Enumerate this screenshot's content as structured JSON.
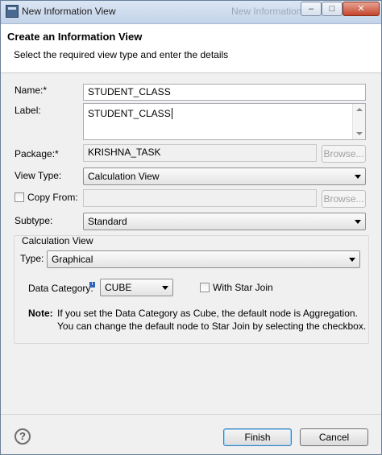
{
  "window": {
    "title": "New Information View",
    "ghost_title": "New Information View",
    "min_glyph": "–",
    "max_glyph": "□",
    "close_glyph": "✕"
  },
  "header": {
    "title": "Create an Information View",
    "subtitle": "Select the required view type and enter the details"
  },
  "form": {
    "name_label": "Name:*",
    "name_value": "STUDENT_CLASS",
    "label_label": "Label:",
    "label_value": "STUDENT_CLASS",
    "package_label": "Package:*",
    "package_value": "KRISHNA_TASK",
    "browse_label": "Browse...",
    "view_type_label": "View Type:",
    "view_type_value": "Calculation View",
    "copy_from_label": "Copy From:",
    "copy_from_value": "",
    "subtype_label": "Subtype:",
    "subtype_value": "Standard"
  },
  "calc_group": {
    "title": "Calculation View",
    "type_label": "Type:",
    "type_value": "Graphical",
    "data_category_label": "Data Category:",
    "data_category_value": "CUBE",
    "star_join_label": "With Star Join",
    "note_bold": "Note:",
    "note_line1": "If you set the Data Category as Cube, the default node is Aggregation.",
    "note_line2": "You can change the default node to Star Join by selecting the checkbox."
  },
  "footer": {
    "help_glyph": "?",
    "finish_label": "Finish",
    "cancel_label": "Cancel"
  },
  "colors": {
    "title_bar": "#c3d3e8",
    "close_button": "#c4452c",
    "default_button_border": "#3c7fb1"
  },
  "icons": [
    "app-icon",
    "info-icon",
    "help-icon",
    "dropdown-arrow-icon"
  ]
}
